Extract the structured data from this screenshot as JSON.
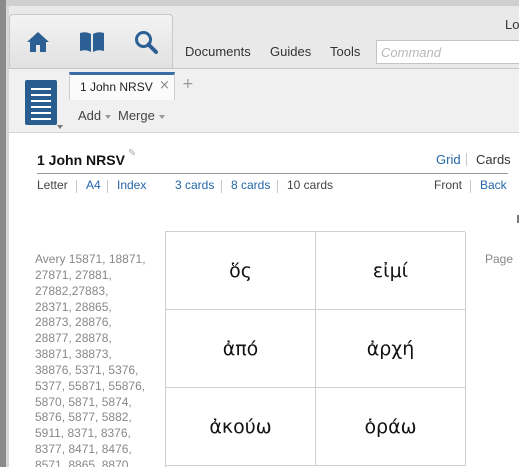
{
  "toolbar": {
    "menu": [
      "Documents",
      "Guides",
      "Tools"
    ],
    "command_placeholder": "Command",
    "user_fragment": "Lo"
  },
  "tabs": {
    "active_label": "1 John NRSV",
    "close_glyph": "×",
    "new_tab_glyph": "+",
    "add_label": "Add",
    "merge_label": "Merge"
  },
  "document": {
    "title": "1 John NRSV",
    "view_grid": "Grid",
    "view_cards": "Cards",
    "paper": [
      "Letter",
      "A4",
      "Index"
    ],
    "cards_per_page": [
      "3 cards",
      "8 cards",
      "10 cards"
    ],
    "sides": [
      "Front",
      "Back"
    ],
    "avery_lines": [
      "Avery 15871, 18871,",
      "27871, 27881,",
      "27882,27883,",
      "28371, 28865,",
      "28873, 28876,",
      "28877, 28878,",
      "38871, 38873,",
      "38876, 5371, 5376,",
      "5377, 55871, 55876,",
      "5870, 5871, 5874,",
      "5876, 5877, 5882,",
      "5911, 8371, 8376,",
      "8377, 8471, 8476,",
      "8571, 8865, 8870"
    ],
    "page_label": "Page"
  },
  "cards": [
    "ὅς",
    "εἰμί",
    "ἀπό",
    "ἀρχή",
    "ἀκούω",
    "ὁράω"
  ],
  "colors": {
    "link": "#2666a8",
    "panel_icon": "#2a5d8f",
    "tab_accent": "#3a6ea5"
  }
}
